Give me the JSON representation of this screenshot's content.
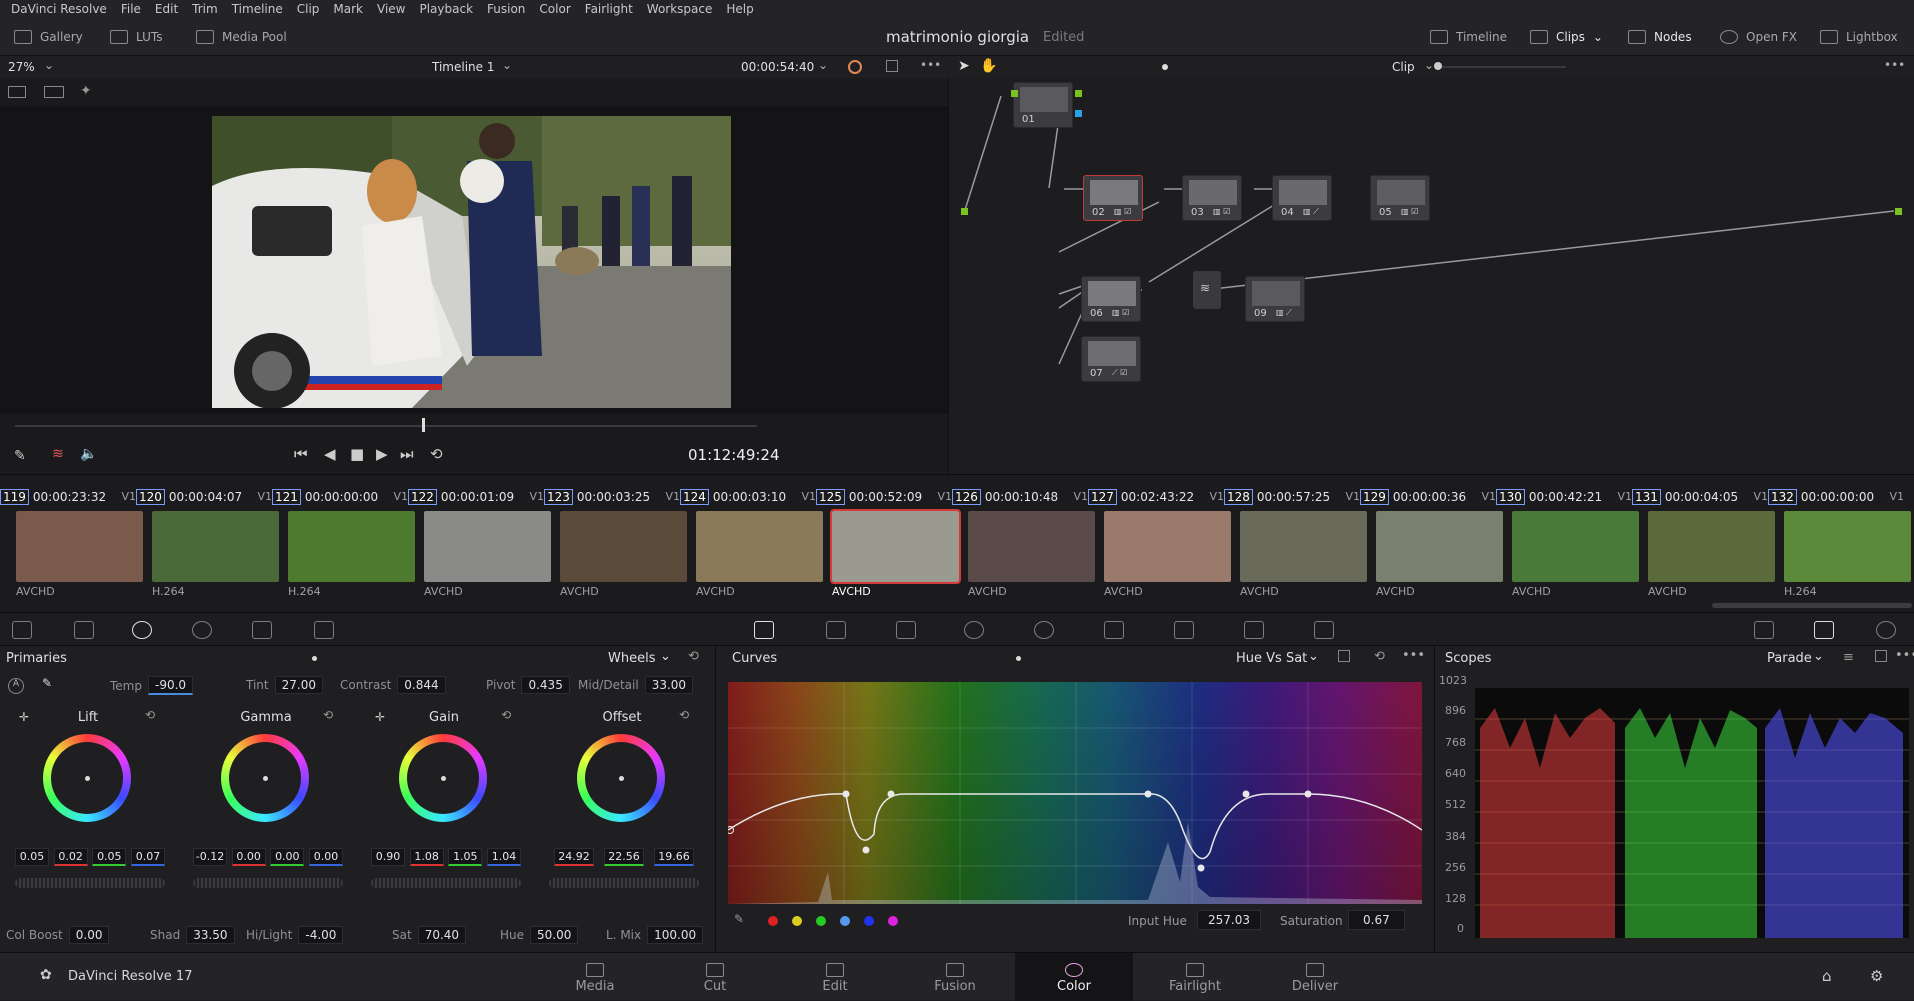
{
  "menu": [
    "DaVinci Resolve",
    "File",
    "Edit",
    "Trim",
    "Timeline",
    "Clip",
    "Mark",
    "View",
    "Playback",
    "Fusion",
    "Color",
    "Fairlight",
    "Workspace",
    "Help"
  ],
  "toolbar": {
    "gallery": "Gallery",
    "luts": "LUTs",
    "media_pool": "Media Pool",
    "project_title": "matrimonio giorgia",
    "project_status": "Edited",
    "timeline": "Timeline",
    "clips": "Clips",
    "nodes": "Nodes",
    "open_fx": "Open FX",
    "lightbox": "Lightbox"
  },
  "viewer": {
    "zoom": "27%",
    "timeline_name": "Timeline 1",
    "timecode": "00:00:54:40",
    "playhead_timecode": "01:12:49:24",
    "playhead_position": 0.5
  },
  "node_editor": {
    "mode": "Clip",
    "nodes": [
      "01",
      "02",
      "03",
      "04",
      "05",
      "06",
      "07",
      "09"
    ]
  },
  "clips": [
    {
      "num": "119",
      "tc": "00:00:23:32",
      "track": "V1",
      "codec": "AVCHD",
      "color": "#7a5a4a"
    },
    {
      "num": "120",
      "tc": "00:00:04:07",
      "track": "V1",
      "codec": "H.264",
      "color": "#4b6a3a"
    },
    {
      "num": "121",
      "tc": "00:00:00:00",
      "track": "V1",
      "codec": "H.264",
      "color": "#4e7a30"
    },
    {
      "num": "122",
      "tc": "00:00:01:09",
      "track": "V1",
      "codec": "AVCHD",
      "color": "#8a8a88"
    },
    {
      "num": "123",
      "tc": "00:00:03:25",
      "track": "V1",
      "codec": "AVCHD",
      "color": "#5a4a3a"
    },
    {
      "num": "124",
      "tc": "00:00:03:10",
      "track": "V1",
      "codec": "AVCHD",
      "color": "#8a7a5a"
    },
    {
      "num": "125",
      "tc": "00:00:52:09",
      "track": "V1",
      "codec": "AVCHD",
      "color": "#9a9a90"
    },
    {
      "num": "126",
      "tc": "00:00:10:48",
      "track": "V1",
      "codec": "AVCHD",
      "color": "#5a4a4a"
    },
    {
      "num": "127",
      "tc": "00:02:43:22",
      "track": "V1",
      "codec": "AVCHD",
      "color": "#9a7a6a"
    },
    {
      "num": "128",
      "tc": "00:00:57:25",
      "track": "V1",
      "codec": "AVCHD",
      "color": "#6a6a5a"
    },
    {
      "num": "129",
      "tc": "00:00:00:36",
      "track": "V1",
      "codec": "AVCHD",
      "color": "#7a8070"
    },
    {
      "num": "130",
      "tc": "00:00:42:21",
      "track": "V1",
      "codec": "AVCHD",
      "color": "#4a7a3a"
    },
    {
      "num": "131",
      "tc": "00:00:04:05",
      "track": "V1",
      "codec": "AVCHD",
      "color": "#5a6a3a"
    },
    {
      "num": "132",
      "tc": "00:00:00:00",
      "track": "V1",
      "codec": "H.264",
      "color": "#5a8a3a"
    }
  ],
  "primaries": {
    "title": "Primaries",
    "mode": "Wheels",
    "temp_label": "Temp",
    "temp": "-90.0",
    "tint_label": "Tint",
    "tint": "27.00",
    "contrast_label": "Contrast",
    "contrast": "0.844",
    "pivot_label": "Pivot",
    "pivot": "0.435",
    "middetail_label": "Mid/Detail",
    "middetail": "33.00",
    "wheels": [
      {
        "name": "Lift",
        "vals": [
          "0.05",
          "0.02",
          "0.05",
          "0.07"
        ]
      },
      {
        "name": "Gamma",
        "vals": [
          "-0.12",
          "0.00",
          "0.00",
          "0.00"
        ]
      },
      {
        "name": "Gain",
        "vals": [
          "0.90",
          "1.08",
          "1.05",
          "1.04"
        ]
      },
      {
        "name": "Offset",
        "vals": [
          "24.92",
          "22.56",
          "19.66",
          ""
        ]
      }
    ],
    "colboost_label": "Col Boost",
    "colboost": "0.00",
    "shad_label": "Shad",
    "shad": "33.50",
    "hilight_label": "Hi/Light",
    "hilight": "-4.00",
    "sat_label": "Sat",
    "sat": "70.40",
    "hue_label": "Hue",
    "hue": "50.00",
    "lmix_label": "L. Mix",
    "lmix": "100.00"
  },
  "curves": {
    "title": "Curves",
    "mode": "Hue Vs Sat",
    "input_hue_label": "Input Hue",
    "input_hue": "257.03",
    "saturation_label": "Saturation",
    "saturation": "0.67"
  },
  "scopes": {
    "title": "Scopes",
    "mode": "Parade",
    "ticks": [
      "1023",
      "896",
      "768",
      "640",
      "512",
      "384",
      "256",
      "128",
      "0"
    ]
  },
  "nav": {
    "app": "DaVinci Resolve 17",
    "pages": [
      "Media",
      "Cut",
      "Edit",
      "Fusion",
      "Color",
      "Fairlight",
      "Deliver"
    ],
    "active": "Color"
  }
}
